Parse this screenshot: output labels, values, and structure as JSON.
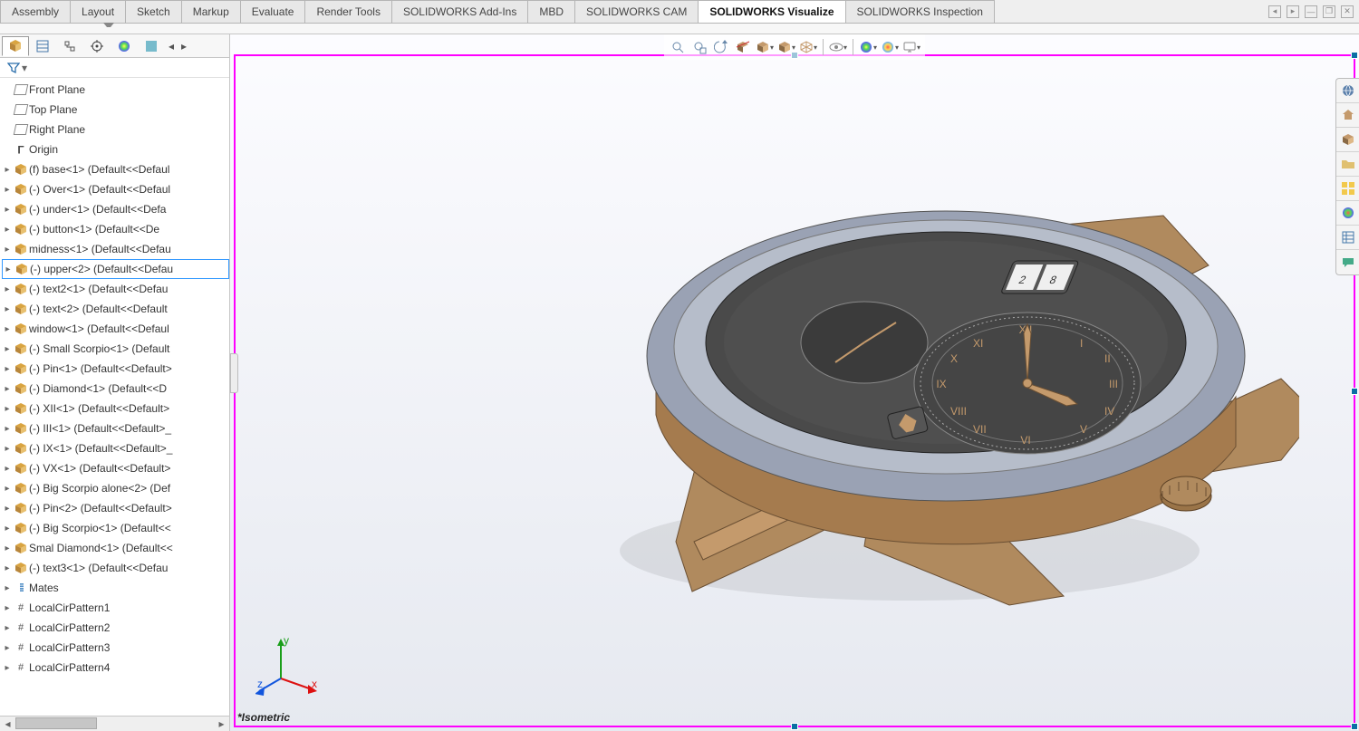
{
  "ribbon": {
    "tabs": [
      "Assembly",
      "Layout",
      "Sketch",
      "Markup",
      "Evaluate",
      "Render Tools",
      "SOLIDWORKS Add-Ins",
      "MBD",
      "SOLIDWORKS CAM",
      "SOLIDWORKS Visualize",
      "SOLIDWORKS Inspection"
    ],
    "active": "SOLIDWORKS Visualize"
  },
  "tree": {
    "planes": [
      "Front Plane",
      "Top Plane",
      "Right Plane"
    ],
    "origin": "Origin",
    "components": [
      "(f) base<1> (Default<<Defaul",
      "(-) Over<1> (Default<<Defaul",
      "(-) under<1> (Default<<Defa",
      "(-) button<1> (Default<<De",
      "midness<1> (Default<<Defau",
      "(-) upper<2> (Default<<Defau",
      "(-) text2<1> (Default<<Defau",
      "(-) text<2> (Default<<Default",
      "window<1> (Default<<Defaul",
      "(-) Small Scorpio<1> (Default",
      "(-) Pin<1> (Default<<Default>",
      "(-) Diamond<1> (Default<<D",
      "(-) XII<1> (Default<<Default>",
      "(-) III<1> (Default<<Default>_",
      "(-) IX<1> (Default<<Default>_",
      "(-) VX<1> (Default<<Default>",
      "(-) Big Scorpio alone<2> (Def",
      "(-) Pin<2> (Default<<Default>",
      "(-) Big Scorpio<1> (Default<<",
      "Smal Diamond<1> (Default<<",
      "(-) text3<1> (Default<<Defau"
    ],
    "selected_index": 5,
    "mates": "Mates",
    "patterns": [
      "LocalCirPattern1",
      "LocalCirPattern2",
      "LocalCirPattern3",
      "LocalCirPattern4"
    ]
  },
  "viewport": {
    "orientation_label": "*Isometric",
    "date_display": "28"
  }
}
